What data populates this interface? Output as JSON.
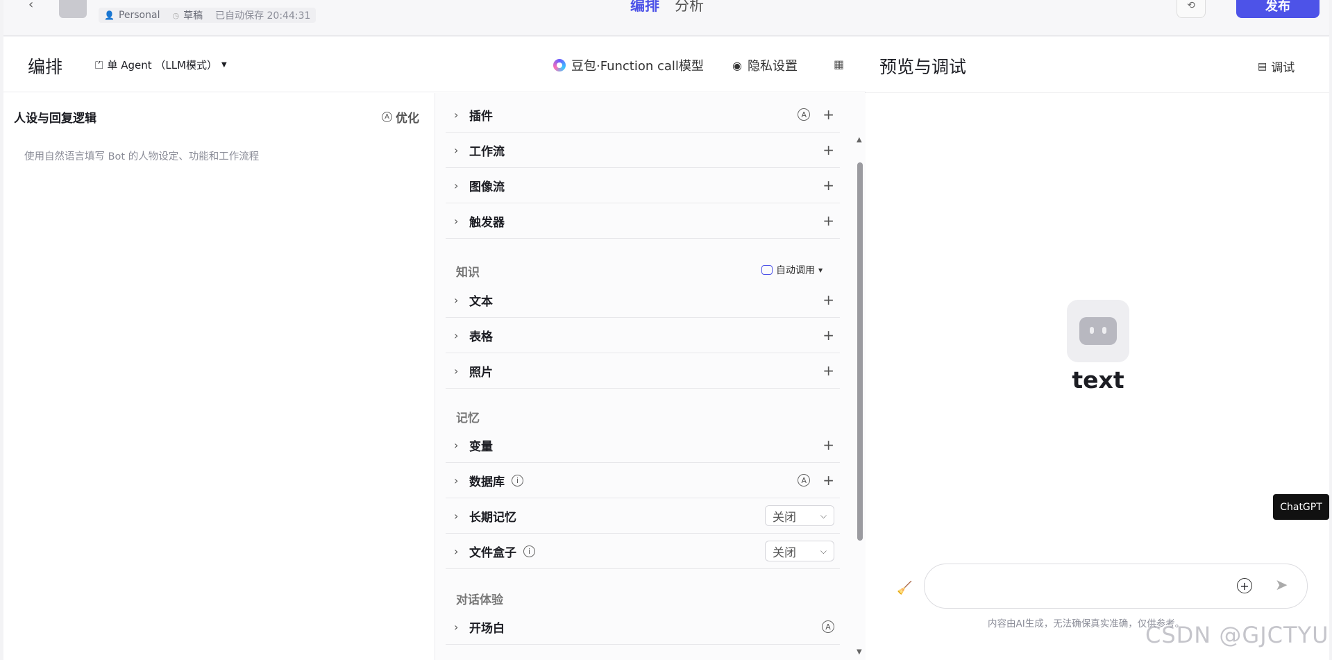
{
  "topbar": {
    "workspace": "Personal",
    "status": "草稿",
    "saved": "已自动保存 20:44:31",
    "tabs": [
      "编排",
      "分析"
    ],
    "publish": "发布"
  },
  "editor": {
    "title": "编排",
    "mode": "单 Agent （LLM模式）",
    "model": "豆包·Function call模型",
    "privacy": "隐私设置"
  },
  "persona": {
    "title": "人设与回复逻辑",
    "optimize": "优化",
    "placeholder": "使用自然语言填写 Bot 的人物设定、功能和工作流程"
  },
  "skills": {
    "items": [
      {
        "label": "插件"
      },
      {
        "label": "工作流"
      },
      {
        "label": "图像流"
      },
      {
        "label": "触发器"
      }
    ],
    "knowledge_title": "知识",
    "knowledge_mode": "自动调用",
    "knowledge": [
      {
        "label": "文本"
      },
      {
        "label": "表格"
      },
      {
        "label": "照片"
      }
    ],
    "memory_title": "记忆",
    "memory": [
      {
        "label": "变量"
      },
      {
        "label": "数据库"
      },
      {
        "label": "长期记忆",
        "value": "关闭"
      },
      {
        "label": "文件盒子",
        "value": "关闭"
      }
    ],
    "experience_title": "对话体验",
    "experience": [
      {
        "label": "开场白"
      }
    ]
  },
  "preview": {
    "title": "预览与调试",
    "debug": "调试",
    "bot_name": "text",
    "disclaimer": "内容由AI生成，无法确保真实准确，仅供参考。"
  },
  "floating": {
    "chatgpt": "ChatGPT",
    "watermark": "CSDN @GJCTYU"
  }
}
